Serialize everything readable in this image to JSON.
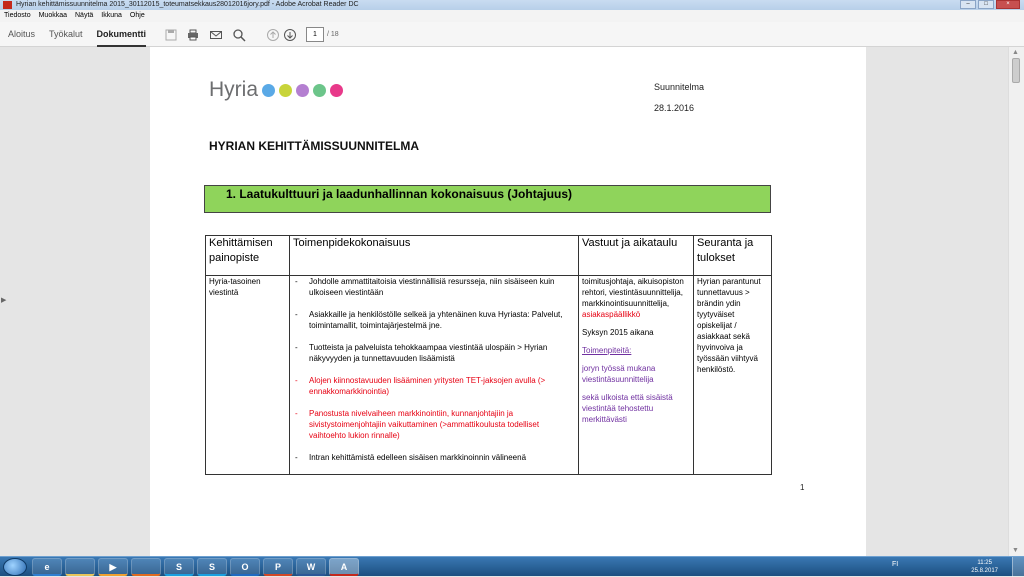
{
  "window": {
    "title": "Hyrian kehittämissuunnitelma 2015_30112015_toteumatsekkaus28012016jory.pdf - Adobe Acrobat Reader DC"
  },
  "menu": [
    "Tiedosto",
    "Muokkaa",
    "Näytä",
    "Ikkuna",
    "Ohje"
  ],
  "tabs": [
    "Aloitus",
    "Työkalut",
    "Dokumentti"
  ],
  "toolbar": {
    "icons": [
      "save-icon",
      "print-icon",
      "email-icon",
      "search-icon",
      "page-up-icon",
      "page-down-icon"
    ],
    "page_current": "1",
    "page_total": "/ 18"
  },
  "document": {
    "logo_text": "Hyria",
    "logo_colors": [
      "#5aa9e6",
      "#c8d43a",
      "#b47fd1",
      "#6cc58a",
      "#e8398a"
    ],
    "meta_type": "Suunnitelma",
    "meta_date": "28.1.2016",
    "title": "HYRIAN KEHITTÄMISSUUNNITELMA",
    "section": "1. Laatukulttuuri ja laadunhallinnan kokonaisuus (Johtajuus)",
    "section_color": "#8fd45b",
    "table": {
      "headers": [
        "Kehittämisen painopiste",
        "Toimenpidekokonaisuus",
        "Vastuut ja aikataulu",
        "Seuranta ja tulokset"
      ],
      "focus": "Hyria-tasoinen viestintä",
      "actions": [
        {
          "text": "Johdolle ammattitaitoisia viestinnällisiä resursseja, niin sisäiseen kuin ulkoiseen viestintään",
          "color": "black"
        },
        {
          "text": "Asiakkaille ja henkilöstölle selkeä ja yhtenäinen kuva Hyriasta: Palvelut, toimintamallit, toimintajärjestelmä jne.",
          "color": "black"
        },
        {
          "text": "Tuotteista ja palveluista tehokkaampaa viestintää ulospäin > Hyrian näkyvyyden ja tunnettavuuden lisäämistä",
          "color": "black"
        },
        {
          "text": "Alojen kiinnostavuuden lisääminen yritysten TET-jaksojen avulla (> ennakkomarkkinointia)",
          "color": "red"
        },
        {
          "text": "Panostusta nivelvaiheen markkinointiin, kunnanjohtajiin ja sivistystoimenjohtajiin vaikuttaminen (>ammattikoulusta todelliset vaihtoehto lukion rinnalle)",
          "color": "red"
        },
        {
          "text": "Intran kehittämistä edelleen sisäisen markkinoinnin välineenä",
          "color": "black"
        }
      ],
      "responsibility_roles": "toimitusjohtaja, aikuisopiston rehtori, viestintäsuunnittelija, markkinointisuunnittelija,",
      "responsibility_red": "asiakaspäällikkö",
      "schedule": "Syksyn 2015 aikana",
      "measures_label": "Toimenpiteitä:",
      "measure_1": "joryn työssä mukana viestintäsuunnittelija",
      "measure_2": "sekä ulkoista että sisäistä viestintää tehostettu merkittävästi",
      "results": "Hyrian parantunut tunnettavuus > brändin ydin tyytyväiset opiskelijat / asiakkaat sekä hyvinvoiva ja työssään viihtyvä henkilöstö."
    },
    "page_number": "1"
  },
  "taskbar": {
    "apps": [
      "internet-explorer",
      "file-explorer",
      "media-player",
      "firefox",
      "skype",
      "skype-business",
      "outlook",
      "powerpoint",
      "word",
      "acrobat"
    ],
    "app_labels": [
      "e",
      "",
      "▶",
      "",
      "S",
      "S",
      "O",
      "P",
      "W",
      "A"
    ],
    "lang": "FI",
    "time": "11:25",
    "date": "25.8.2017"
  }
}
